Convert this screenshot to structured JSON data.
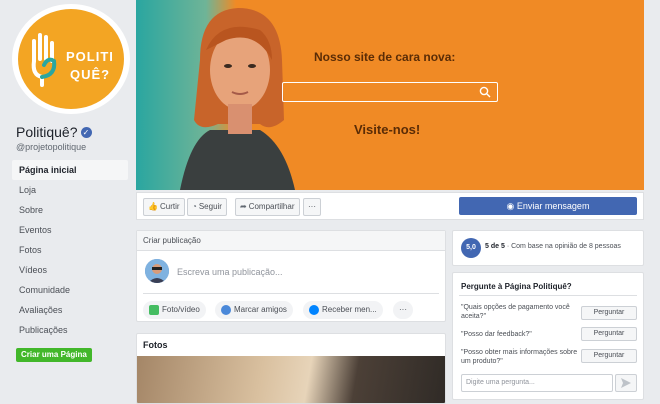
{
  "page": {
    "name": "Politiquê?",
    "handle": "@projetopolitique",
    "logo_line1": "POLITI",
    "logo_line2": "QUÊ?"
  },
  "sidebar": {
    "items": [
      {
        "label": "Página inicial",
        "active": true
      },
      {
        "label": "Loja"
      },
      {
        "label": "Sobre"
      },
      {
        "label": "Eventos"
      },
      {
        "label": "Fotos"
      },
      {
        "label": "Vídeos"
      },
      {
        "label": "Comunidade"
      },
      {
        "label": "Avaliações"
      },
      {
        "label": "Publicações"
      }
    ],
    "create_page_label": "Criar uma Página"
  },
  "cover": {
    "headline": "Nosso site de cara nova:",
    "cta": "Visite-nos!"
  },
  "actions": {
    "like": "Curtir",
    "follow": "Seguir",
    "share": "Compartilhar",
    "more": "···",
    "send_message": "Enviar mensagem"
  },
  "create_post": {
    "title": "Criar publicação",
    "placeholder": "Escreva uma publicação...",
    "photo_video": "Foto/vídeo",
    "tag_friends": "Marcar amigos",
    "get_messages": "Receber men...",
    "more": "···"
  },
  "photos": {
    "title": "Fotos"
  },
  "rating": {
    "score": "5,0",
    "of": "5 de 5",
    "sep": "·",
    "basis": "Com base na opinião de 8 pessoas"
  },
  "ask": {
    "title": "Pergunte à Página Politiquê?",
    "questions": [
      {
        "text": "\"Quais opções de pagamento você aceita?\"",
        "button": "Perguntar"
      },
      {
        "text": "\"Posso dar feedback?\"",
        "button": "Perguntar"
      },
      {
        "text": "\"Posso obter mais informações sobre um produto?\"",
        "button": "Perguntar"
      }
    ],
    "input_placeholder": "Digite uma pergunta..."
  },
  "colors": {
    "brand_blue": "#4267b2",
    "cover_orange": "#f08a25",
    "create_green": "#42b72a"
  }
}
